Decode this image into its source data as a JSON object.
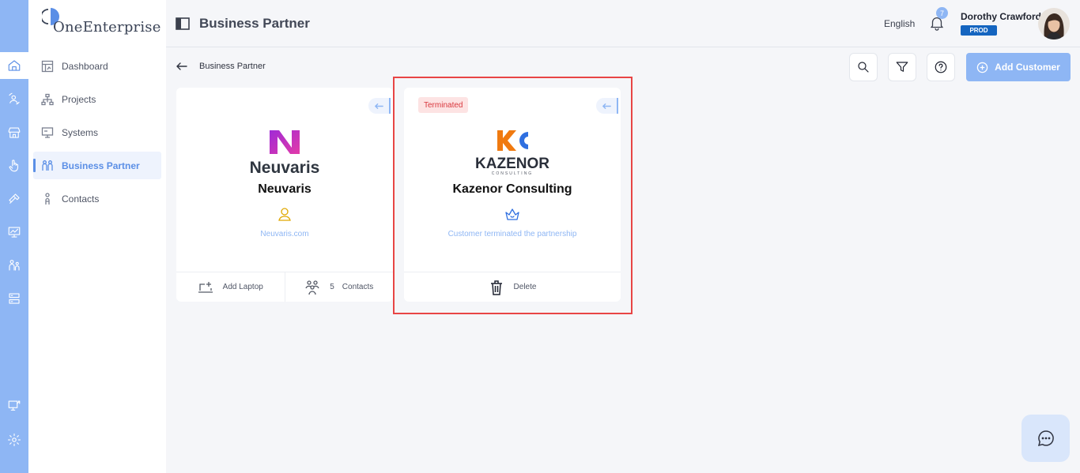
{
  "brand": {
    "name": "OneEnterprise"
  },
  "sidebar": {
    "items": [
      {
        "label": "Dashboard",
        "icon": "dashboard-icon"
      },
      {
        "label": "Projects",
        "icon": "hierarchy-icon"
      },
      {
        "label": "Systems",
        "icon": "systems-icon"
      },
      {
        "label": "Business Partner",
        "icon": "partners-icon",
        "active": true
      },
      {
        "label": "Contacts",
        "icon": "person-icon"
      }
    ]
  },
  "header": {
    "title": "Business Partner",
    "language": "English",
    "notifications_count": "7",
    "user_name": "Dorothy Crawford",
    "environment": "PROD"
  },
  "breadcrumb": {
    "current": "Business Partner"
  },
  "toolbar": {
    "add_label": "Add Customer"
  },
  "cards": [
    {
      "name": "Neuvaris",
      "logo_text": "Neuvaris",
      "subtitle": "Neuvaris.com",
      "icon": "user-icon",
      "footer": {
        "add_label": "Add Laptop",
        "contacts_count": "5",
        "contacts_label": "Contacts"
      }
    },
    {
      "name": "Kazenor Consulting",
      "logo_text": "KAZENOR",
      "logo_subtext": "CONSULTING",
      "status": "Terminated",
      "subtitle": "Customer terminated the partnership",
      "icon": "crown-icon",
      "footer": {
        "delete_label": "Delete"
      }
    }
  ],
  "colors": {
    "accent": "#8eb6f4",
    "primary": "#5b8fe6",
    "danger": "#e84545",
    "env_badge": "#1565c0"
  }
}
